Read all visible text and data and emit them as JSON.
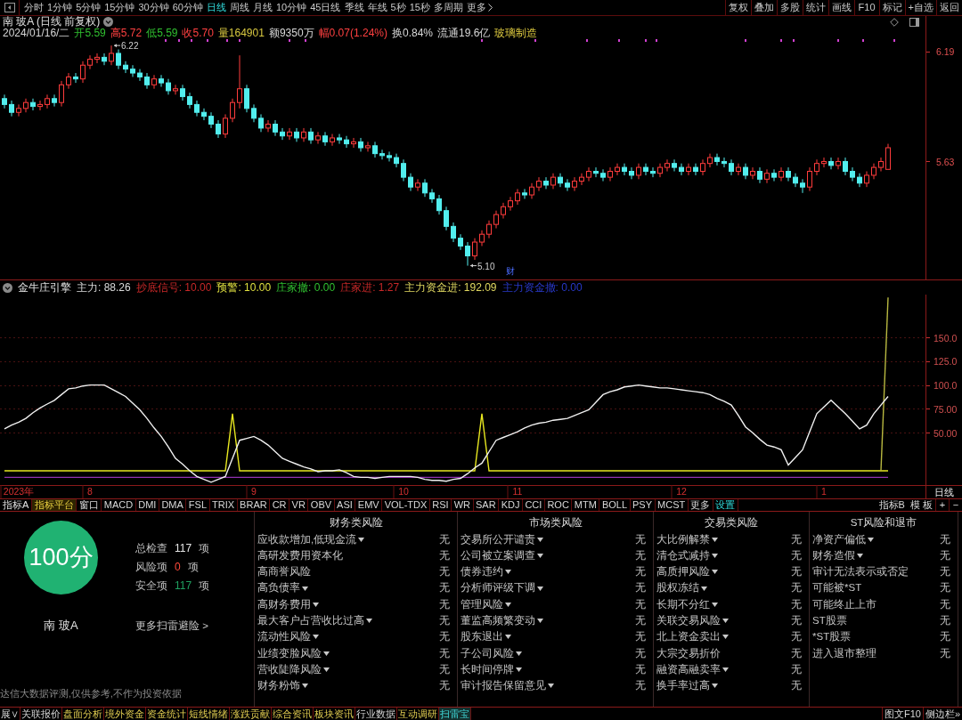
{
  "toolbar": {
    "periods": [
      {
        "label": "分时",
        "selected": false
      },
      {
        "label": "1分钟",
        "selected": false
      },
      {
        "label": "5分钟",
        "selected": false
      },
      {
        "label": "15分钟",
        "selected": false
      },
      {
        "label": "30分钟",
        "selected": false
      },
      {
        "label": "60分钟",
        "selected": false
      },
      {
        "label": "日线",
        "selected": true
      },
      {
        "label": "周线",
        "selected": false
      },
      {
        "label": "月线",
        "selected": false
      },
      {
        "label": "10分钟",
        "selected": false
      },
      {
        "label": "45日线",
        "selected": false
      },
      {
        "label": "季线",
        "selected": false
      },
      {
        "label": "年线",
        "selected": false
      },
      {
        "label": "5秒",
        "selected": false
      },
      {
        "label": "15秒",
        "selected": false
      },
      {
        "label": "多周期",
        "selected": false
      }
    ],
    "more": "更多",
    "actions": [
      "复权",
      "叠加",
      "多股",
      "统计",
      "画线",
      "F10",
      "标记",
      "+自选",
      "返回"
    ]
  },
  "chart_header": {
    "title": "南 玻A (日线 前复权)",
    "quote": [
      {
        "text": "2024/01/16/二",
        "color": "#d8d8d8"
      },
      {
        "text": "开5.59",
        "color": "#30c030"
      },
      {
        "text": "高5.72",
        "color": "#ff4040"
      },
      {
        "text": "低5.59",
        "color": "#30c030"
      },
      {
        "text": "收5.70",
        "color": "#ff4040"
      },
      {
        "text": "量164901",
        "color": "#d8c840"
      },
      {
        "text": "额9350万",
        "color": "#d8d8d8"
      },
      {
        "text": "幅0.07(1.24%)",
        "color": "#ff4040"
      },
      {
        "text": "换0.84%",
        "color": "#d8d8d8"
      },
      {
        "text": "流通19.6亿",
        "color": "#d8d8d8"
      }
    ],
    "sector": "玻璃制造"
  },
  "price_chart": {
    "chart_data": {
      "type": "candlestick",
      "ylim": [
        5.03,
        6.37
      ],
      "yticks": [
        {
          "value": 5.63,
          "label": "5.63"
        },
        {
          "value": 6.19,
          "label": "6.19"
        }
      ],
      "annotations": [
        "6.22",
        "5.10",
        "财"
      ],
      "ohlc": [
        [
          5.95,
          5.97,
          5.9,
          5.92
        ],
        [
          5.92,
          5.94,
          5.86,
          5.88
        ],
        [
          5.88,
          5.92,
          5.86,
          5.9
        ],
        [
          5.9,
          5.95,
          5.88,
          5.93
        ],
        [
          5.93,
          5.95,
          5.89,
          5.91
        ],
        [
          5.91,
          5.94,
          5.89,
          5.92
        ],
        [
          5.92,
          5.97,
          5.9,
          5.95
        ],
        [
          5.95,
          5.97,
          5.91,
          5.93
        ],
        [
          5.93,
          6.04,
          5.91,
          6.02
        ],
        [
          6.02,
          6.08,
          6.0,
          6.06
        ],
        [
          6.06,
          6.08,
          6.03,
          6.05
        ],
        [
          6.05,
          6.14,
          6.03,
          6.12
        ],
        [
          6.12,
          6.17,
          6.1,
          6.15
        ],
        [
          6.15,
          6.18,
          6.13,
          6.16
        ],
        [
          6.16,
          6.18,
          6.12,
          6.14
        ],
        [
          6.14,
          6.22,
          6.12,
          6.18
        ],
        [
          6.18,
          6.2,
          6.1,
          6.12
        ],
        [
          6.12,
          6.14,
          6.08,
          6.1
        ],
        [
          6.1,
          6.12,
          6.06,
          6.08
        ],
        [
          6.08,
          6.1,
          6.04,
          6.06
        ],
        [
          6.06,
          6.08,
          6.0,
          6.02
        ],
        [
          6.02,
          6.07,
          6.0,
          6.05
        ],
        [
          6.05,
          6.07,
          6.01,
          6.03
        ],
        [
          6.03,
          6.05,
          5.97,
          5.99
        ],
        [
          5.99,
          6.02,
          5.97,
          6.0
        ],
        [
          6.0,
          6.02,
          5.94,
          5.96
        ],
        [
          5.96,
          5.98,
          5.9,
          5.92
        ],
        [
          5.92,
          5.94,
          5.86,
          5.88
        ],
        [
          5.88,
          5.9,
          5.84,
          5.86
        ],
        [
          5.86,
          5.88,
          5.8,
          5.82
        ],
        [
          5.82,
          5.84,
          5.75,
          5.77
        ],
        [
          5.77,
          5.87,
          5.75,
          5.85
        ],
        [
          5.85,
          5.95,
          5.83,
          5.93
        ],
        [
          5.93,
          6.17,
          5.9,
          6.0
        ],
        [
          6.0,
          6.02,
          5.88,
          5.9
        ],
        [
          5.9,
          5.92,
          5.83,
          5.85
        ],
        [
          5.85,
          5.87,
          5.78,
          5.8
        ],
        [
          5.8,
          5.84,
          5.78,
          5.82
        ],
        [
          5.82,
          5.84,
          5.76,
          5.78
        ],
        [
          5.78,
          5.8,
          5.74,
          5.76
        ],
        [
          5.76,
          5.8,
          5.74,
          5.78
        ],
        [
          5.78,
          5.8,
          5.73,
          5.75
        ],
        [
          5.75,
          5.8,
          5.73,
          5.78
        ],
        [
          5.78,
          5.8,
          5.72,
          5.74
        ],
        [
          5.74,
          5.78,
          5.72,
          5.76
        ],
        [
          5.76,
          5.78,
          5.71,
          5.73
        ],
        [
          5.73,
          5.77,
          5.71,
          5.75
        ],
        [
          5.75,
          5.77,
          5.72,
          5.74
        ],
        [
          5.74,
          5.76,
          5.7,
          5.72
        ],
        [
          5.72,
          5.75,
          5.7,
          5.73
        ],
        [
          5.73,
          5.75,
          5.68,
          5.7
        ],
        [
          5.7,
          5.73,
          5.68,
          5.71
        ],
        [
          5.71,
          5.73,
          5.65,
          5.67
        ],
        [
          5.67,
          5.69,
          5.64,
          5.66
        ],
        [
          5.66,
          5.68,
          5.63,
          5.65
        ],
        [
          5.65,
          5.67,
          5.6,
          5.62
        ],
        [
          5.62,
          5.64,
          5.53,
          5.55
        ],
        [
          5.55,
          5.57,
          5.48,
          5.5
        ],
        [
          5.5,
          5.54,
          5.48,
          5.52
        ],
        [
          5.52,
          5.54,
          5.45,
          5.47
        ],
        [
          5.47,
          5.49,
          5.42,
          5.44
        ],
        [
          5.44,
          5.46,
          5.36,
          5.38
        ],
        [
          5.38,
          5.4,
          5.28,
          5.3
        ],
        [
          5.3,
          5.32,
          5.22,
          5.24
        ],
        [
          5.24,
          5.26,
          5.18,
          5.2
        ],
        [
          5.2,
          5.22,
          5.1,
          5.15
        ],
        [
          5.15,
          5.24,
          5.13,
          5.22
        ],
        [
          5.22,
          5.28,
          5.2,
          5.26
        ],
        [
          5.26,
          5.33,
          5.24,
          5.31
        ],
        [
          5.31,
          5.38,
          5.29,
          5.36
        ],
        [
          5.36,
          5.42,
          5.34,
          5.4
        ],
        [
          5.4,
          5.45,
          5.38,
          5.43
        ],
        [
          5.43,
          5.49,
          5.41,
          5.47
        ],
        [
          5.47,
          5.49,
          5.44,
          5.46
        ],
        [
          5.46,
          5.52,
          5.44,
          5.5
        ],
        [
          5.5,
          5.55,
          5.48,
          5.53
        ],
        [
          5.53,
          5.55,
          5.49,
          5.51
        ],
        [
          5.51,
          5.57,
          5.49,
          5.55
        ],
        [
          5.55,
          5.57,
          5.5,
          5.52
        ],
        [
          5.52,
          5.54,
          5.48,
          5.5
        ],
        [
          5.5,
          5.55,
          5.48,
          5.53
        ],
        [
          5.53,
          5.57,
          5.51,
          5.55
        ],
        [
          5.55,
          5.6,
          5.53,
          5.58
        ],
        [
          5.58,
          5.6,
          5.55,
          5.57
        ],
        [
          5.57,
          5.59,
          5.53,
          5.55
        ],
        [
          5.55,
          5.6,
          5.53,
          5.58
        ],
        [
          5.58,
          5.62,
          5.56,
          5.6
        ],
        [
          5.6,
          5.62,
          5.56,
          5.58
        ],
        [
          5.58,
          5.6,
          5.54,
          5.56
        ],
        [
          5.56,
          5.62,
          5.54,
          5.6
        ],
        [
          5.6,
          5.62,
          5.56,
          5.58
        ],
        [
          5.58,
          5.6,
          5.55,
          5.57
        ],
        [
          5.57,
          5.62,
          5.55,
          5.6
        ],
        [
          5.6,
          5.64,
          5.58,
          5.62
        ],
        [
          5.62,
          5.64,
          5.58,
          5.6
        ],
        [
          5.6,
          5.62,
          5.56,
          5.58
        ],
        [
          5.58,
          5.62,
          5.56,
          5.6
        ],
        [
          5.6,
          5.62,
          5.56,
          5.58
        ],
        [
          5.58,
          5.64,
          5.56,
          5.62
        ],
        [
          5.62,
          5.67,
          5.6,
          5.65
        ],
        [
          5.65,
          5.67,
          5.61,
          5.63
        ],
        [
          5.63,
          5.65,
          5.6,
          5.62
        ],
        [
          5.62,
          5.64,
          5.56,
          5.58
        ],
        [
          5.58,
          5.62,
          5.56,
          5.6
        ],
        [
          5.6,
          5.62,
          5.54,
          5.56
        ],
        [
          5.56,
          5.6,
          5.54,
          5.58
        ],
        [
          5.58,
          5.6,
          5.52,
          5.54
        ],
        [
          5.54,
          5.59,
          5.52,
          5.57
        ],
        [
          5.57,
          5.59,
          5.53,
          5.55
        ],
        [
          5.55,
          5.6,
          5.53,
          5.58
        ],
        [
          5.58,
          5.6,
          5.53,
          5.55
        ],
        [
          5.55,
          5.57,
          5.5,
          5.52
        ],
        [
          5.52,
          5.54,
          5.47,
          5.5
        ],
        [
          5.5,
          5.6,
          5.48,
          5.58
        ],
        [
          5.58,
          5.64,
          5.56,
          5.62
        ],
        [
          5.62,
          5.65,
          5.6,
          5.63
        ],
        [
          5.63,
          5.65,
          5.59,
          5.61
        ],
        [
          5.61,
          5.65,
          5.59,
          5.63
        ],
        [
          5.63,
          5.65,
          5.56,
          5.58
        ],
        [
          5.58,
          5.6,
          5.53,
          5.55
        ],
        [
          5.55,
          5.57,
          5.5,
          5.52
        ],
        [
          5.52,
          5.58,
          5.5,
          5.56
        ],
        [
          5.56,
          5.62,
          5.54,
          5.6
        ],
        [
          5.6,
          5.65,
          5.58,
          5.63
        ],
        [
          5.59,
          5.72,
          5.59,
          5.7
        ]
      ]
    }
  },
  "indicator": {
    "title": "金牛庄引擎",
    "legend": [
      {
        "text": "主力: 88.26",
        "color": "#dcdcdc"
      },
      {
        "text": "抄底信号: 10.00",
        "color": "#c82828"
      },
      {
        "text": "预警: 10.00",
        "color": "#e0e040"
      },
      {
        "text": "庄家撤: 0.00",
        "color": "#30c030"
      },
      {
        "text": "庄家进: 1.27",
        "color": "#c82828"
      },
      {
        "text": "主力资金进: 192.09",
        "color": "#e0d860"
      },
      {
        "text": "主力资金撤: 0.00",
        "color": "#2838c8"
      }
    ],
    "period_label": "日线",
    "chart_data": {
      "type": "line",
      "ylim": [
        -5,
        195
      ],
      "yticks": [
        {
          "value": 50,
          "label": "50.00"
        },
        {
          "value": 75,
          "label": "75.00"
        },
        {
          "value": 100,
          "label": "100.0"
        },
        {
          "value": 125,
          "label": "125.0"
        },
        {
          "value": 150,
          "label": "150.0"
        }
      ],
      "grid": true,
      "categories": [
        null,
        null,
        "2023年",
        null,
        null,
        null,
        null,
        null,
        null,
        null,
        null,
        null,
        "8",
        null,
        null,
        null,
        null,
        null,
        null,
        null,
        null,
        null,
        null,
        null,
        null,
        null,
        null,
        null,
        null,
        null,
        null,
        null,
        null,
        null,
        null,
        "9",
        null,
        null,
        null,
        null,
        null,
        null,
        null,
        null,
        null,
        null,
        null,
        null,
        null,
        null,
        null,
        null,
        null,
        null,
        null,
        null,
        "10",
        null,
        null,
        null,
        null,
        null,
        null,
        null,
        null,
        null,
        null,
        null,
        null,
        null,
        null,
        null,
        "11",
        null,
        null,
        null,
        null,
        null,
        null,
        null,
        null,
        null,
        null,
        null,
        null,
        null,
        null,
        null,
        null,
        null,
        null,
        null,
        null,
        null,
        null,
        "12",
        null,
        null,
        null,
        null,
        null,
        null,
        null,
        null,
        null,
        null,
        null,
        null,
        null,
        null,
        null,
        null,
        null,
        null,
        null,
        "1",
        null,
        null,
        null,
        null,
        null,
        null,
        null,
        null,
        null
      ],
      "series": [
        {
          "color": "#9030b0",
          "values": [
            3,
            3,
            3,
            3,
            3,
            3,
            3,
            3,
            3,
            3,
            3,
            3,
            3,
            3,
            3,
            3,
            3,
            3,
            3,
            3,
            3,
            3,
            3,
            3,
            3,
            3,
            3,
            3,
            3,
            3,
            3,
            3,
            3,
            3,
            3,
            3,
            3,
            3,
            3,
            3,
            3,
            3,
            3,
            3,
            3,
            3,
            3,
            3,
            3,
            3,
            3,
            3,
            3,
            3,
            3,
            3,
            3,
            3,
            3,
            3,
            3,
            3,
            3,
            3,
            3,
            3,
            3,
            3,
            3,
            3,
            3,
            3,
            3,
            3,
            3,
            3,
            3,
            3,
            3,
            3,
            3,
            3,
            3,
            3,
            3,
            3,
            3,
            3,
            3,
            3,
            3,
            3,
            3,
            3,
            3,
            3,
            3,
            3,
            3,
            3,
            3,
            3,
            3,
            3,
            3,
            3,
            3,
            3,
            3,
            3,
            3,
            3,
            3,
            3,
            3,
            3,
            3,
            3,
            3,
            3,
            3,
            3,
            3,
            3,
            3
          ]
        },
        {
          "color": "#e8e820",
          "values": [
            10,
            10,
            10,
            10,
            10,
            10,
            10,
            10,
            10,
            10,
            10,
            10,
            10,
            10,
            10,
            10,
            10,
            10,
            10,
            10,
            10,
            10,
            10,
            10,
            10,
            10,
            10,
            10,
            10,
            10,
            10,
            10,
            70,
            10,
            10,
            10,
            10,
            10,
            10,
            10,
            10,
            10,
            10,
            10,
            10,
            10,
            10,
            10,
            10,
            10,
            10,
            10,
            10,
            10,
            10,
            10,
            10,
            10,
            10,
            10,
            10,
            10,
            10,
            10,
            10,
            10,
            10,
            70,
            10,
            10,
            10,
            10,
            10,
            10,
            10,
            10,
            10,
            10,
            10,
            10,
            10,
            10,
            10,
            10,
            10,
            10,
            10,
            10,
            10,
            10,
            10,
            10,
            10,
            10,
            10,
            10,
            10,
            10,
            10,
            10,
            10,
            10,
            10,
            10,
            10,
            10,
            10,
            10,
            10,
            10,
            10,
            10,
            10,
            10,
            10,
            10,
            10,
            10,
            10,
            10,
            10,
            10,
            10,
            10,
            10
          ]
        },
        {
          "color": "#b8b840",
          "values": [
            null,
            null,
            null,
            null,
            null,
            null,
            null,
            null,
            null,
            null,
            null,
            null,
            null,
            null,
            null,
            null,
            null,
            null,
            null,
            null,
            null,
            null,
            null,
            null,
            null,
            null,
            null,
            null,
            null,
            null,
            null,
            null,
            null,
            null,
            null,
            null,
            null,
            null,
            null,
            null,
            null,
            null,
            null,
            null,
            null,
            null,
            null,
            null,
            null,
            null,
            null,
            null,
            null,
            null,
            null,
            null,
            null,
            null,
            null,
            null,
            null,
            null,
            null,
            null,
            null,
            null,
            null,
            null,
            null,
            null,
            null,
            null,
            null,
            null,
            null,
            null,
            null,
            null,
            null,
            null,
            null,
            null,
            null,
            null,
            null,
            null,
            null,
            null,
            null,
            null,
            null,
            null,
            null,
            null,
            null,
            null,
            null,
            null,
            null,
            null,
            null,
            null,
            null,
            null,
            null,
            null,
            null,
            null,
            null,
            null,
            null,
            null,
            null,
            null,
            null,
            null,
            null,
            null,
            null,
            null,
            null,
            null,
            null,
            10,
            192
          ]
        },
        {
          "color": "#f0f0f0",
          "values": [
            54,
            58,
            61,
            65,
            71,
            76,
            80,
            84,
            90,
            96,
            97,
            99,
            100,
            100,
            100,
            96,
            92,
            88,
            81,
            74,
            65,
            55,
            46,
            35,
            23,
            17,
            10,
            4,
            1,
            -2,
            1,
            4,
            23,
            42,
            44,
            46,
            42,
            37,
            30,
            23,
            20,
            17,
            14,
            12,
            9,
            10,
            10,
            11,
            8,
            4,
            3,
            3,
            2,
            3,
            4,
            4,
            4,
            4,
            3,
            1,
            0,
            0,
            -1,
            1,
            2,
            7,
            13,
            18,
            30,
            42,
            45,
            48,
            51,
            55,
            58,
            60,
            61,
            63,
            64,
            65,
            68,
            71,
            74,
            82,
            90,
            93,
            95,
            98,
            99,
            100,
            99,
            98,
            97,
            97,
            96,
            95,
            94,
            93,
            92,
            90,
            86,
            83,
            79,
            68,
            56,
            50,
            43,
            37,
            35,
            32,
            16,
            24,
            32,
            51,
            70,
            77,
            84,
            77,
            70,
            62,
            54,
            58,
            70,
            79,
            88
          ]
        }
      ]
    }
  },
  "indicator_tabs": {
    "prefix": "指标A",
    "items": [
      {
        "label": "指标平台",
        "selected": true
      },
      {
        "label": "窗口",
        "selected": false
      },
      {
        "label": "MACD",
        "selected": false
      },
      {
        "label": "DMI",
        "selected": false
      },
      {
        "label": "DMA",
        "selected": false
      },
      {
        "label": "FSL",
        "selected": false
      },
      {
        "label": "TRIX",
        "selected": false
      },
      {
        "label": "BRAR",
        "selected": false
      },
      {
        "label": "CR",
        "selected": false
      },
      {
        "label": "VR",
        "selected": false
      },
      {
        "label": "OBV",
        "selected": false
      },
      {
        "label": "ASI",
        "selected": false
      },
      {
        "label": "EMV",
        "selected": false
      },
      {
        "label": "VOL-TDX",
        "selected": false
      },
      {
        "label": "RSI",
        "selected": false
      },
      {
        "label": "WR",
        "selected": false
      },
      {
        "label": "SAR",
        "selected": false
      },
      {
        "label": "KDJ",
        "selected": false
      },
      {
        "label": "CCI",
        "selected": false
      },
      {
        "label": "ROC",
        "selected": false
      },
      {
        "label": "MTM",
        "selected": false
      },
      {
        "label": "BOLL",
        "selected": false
      },
      {
        "label": "PSY",
        "selected": false
      },
      {
        "label": "MCST",
        "selected": false
      }
    ],
    "more": "更多",
    "settings": "设置",
    "right": [
      "指标B",
      "模 板"
    ],
    "zoom": [
      "+",
      "−"
    ]
  },
  "risk_scan": {
    "score": "100分",
    "stock": "南 玻A",
    "stats": [
      {
        "label": "总检查",
        "count": "117",
        "unit": "项",
        "kind": "total"
      },
      {
        "label": "风险项",
        "count": "0",
        "unit": "项",
        "kind": "risk"
      },
      {
        "label": "安全项",
        "count": "117",
        "unit": "项",
        "kind": "safe"
      }
    ],
    "more_link": "更多扫雷避险 >",
    "disclaimer": "达信大数据评测,仅供参考,不作为投资依据",
    "categories": [
      {
        "title": "财务类风险",
        "items": [
          {
            "label": "应收款增加,低现金流",
            "dropdown": true,
            "value": "无"
          },
          {
            "label": "高研发费用资本化",
            "dropdown": false,
            "value": "无"
          },
          {
            "label": "高商誉风险",
            "dropdown": false,
            "value": "无"
          },
          {
            "label": "高负债率",
            "dropdown": true,
            "value": "无"
          },
          {
            "label": "高财务费用",
            "dropdown": true,
            "value": "无"
          },
          {
            "label": "最大客户占营收比过高",
            "dropdown": true,
            "value": "无"
          },
          {
            "label": "流动性风险",
            "dropdown": true,
            "value": "无"
          },
          {
            "label": "业绩变脸风险",
            "dropdown": true,
            "value": "无"
          },
          {
            "label": "营收陡降风险",
            "dropdown": true,
            "value": "无"
          },
          {
            "label": "财务粉饰",
            "dropdown": true,
            "value": "无"
          }
        ]
      },
      {
        "title": "市场类风险",
        "items": [
          {
            "label": "交易所公开谴责",
            "dropdown": true,
            "value": "无"
          },
          {
            "label": "公司被立案调查",
            "dropdown": true,
            "value": "无"
          },
          {
            "label": "债券违约",
            "dropdown": true,
            "value": "无"
          },
          {
            "label": "分析师评级下调",
            "dropdown": true,
            "value": "无"
          },
          {
            "label": "管理风险",
            "dropdown": true,
            "value": "无"
          },
          {
            "label": "董监高频繁变动",
            "dropdown": true,
            "value": "无"
          },
          {
            "label": "股东退出",
            "dropdown": true,
            "value": "无"
          },
          {
            "label": "子公司风险",
            "dropdown": true,
            "value": "无"
          },
          {
            "label": "长时间停牌",
            "dropdown": true,
            "value": "无"
          },
          {
            "label": "审计报告保留意见",
            "dropdown": true,
            "value": "无"
          }
        ]
      },
      {
        "title": "交易类风险",
        "items": [
          {
            "label": "大比例解禁",
            "dropdown": true,
            "value": "无"
          },
          {
            "label": "清仓式减持",
            "dropdown": true,
            "value": "无"
          },
          {
            "label": "高质押风险",
            "dropdown": true,
            "value": "无"
          },
          {
            "label": "股权冻结",
            "dropdown": true,
            "value": "无"
          },
          {
            "label": "长期不分红",
            "dropdown": true,
            "value": "无"
          },
          {
            "label": "关联交易风险",
            "dropdown": true,
            "value": "无"
          },
          {
            "label": "北上资金卖出",
            "dropdown": true,
            "value": "无"
          },
          {
            "label": "大宗交易折价",
            "dropdown": false,
            "value": "无"
          },
          {
            "label": "融资高融卖率",
            "dropdown": true,
            "value": "无"
          },
          {
            "label": "换手率过高",
            "dropdown": true,
            "value": "无"
          }
        ]
      },
      {
        "title": "ST风险和退市",
        "items": [
          {
            "label": "净资产偏低",
            "dropdown": true,
            "value": "无"
          },
          {
            "label": "财务造假",
            "dropdown": true,
            "value": "无"
          },
          {
            "label": "审计无法表示或否定",
            "dropdown": false,
            "value": "无"
          },
          {
            "label": "可能被*ST",
            "dropdown": false,
            "value": "无"
          },
          {
            "label": "可能终止上市",
            "dropdown": false,
            "value": "无"
          },
          {
            "label": "ST股票",
            "dropdown": false,
            "value": "无"
          },
          {
            "label": "*ST股票",
            "dropdown": false,
            "value": "无"
          },
          {
            "label": "进入退市整理",
            "dropdown": false,
            "value": "无"
          }
        ]
      }
    ]
  },
  "bottom_bar": {
    "tabs": [
      {
        "label": "展∨",
        "kind": "plain",
        "selected": false
      },
      {
        "label": "关联报价",
        "kind": "plain",
        "selected": false
      },
      {
        "label": "盘面分析",
        "kind": "highlight",
        "selected": false
      },
      {
        "label": "境外资金",
        "kind": "highlight",
        "selected": false
      },
      {
        "label": "资金统计",
        "kind": "highlight",
        "selected": false
      },
      {
        "label": "短线情绪",
        "kind": "highlight",
        "selected": false
      },
      {
        "label": "涨跌贡献",
        "kind": "highlight",
        "selected": false
      },
      {
        "label": "综合资讯",
        "kind": "highlight",
        "selected": false
      },
      {
        "label": "板块资讯",
        "kind": "highlight",
        "selected": false
      },
      {
        "label": "行业数据",
        "kind": "plain",
        "selected": false
      },
      {
        "label": "互动调研",
        "kind": "highlight",
        "selected": false
      },
      {
        "label": "扫雷宝",
        "kind": "active",
        "selected": true
      }
    ],
    "right": [
      "图文F10",
      "侧边栏»"
    ]
  }
}
